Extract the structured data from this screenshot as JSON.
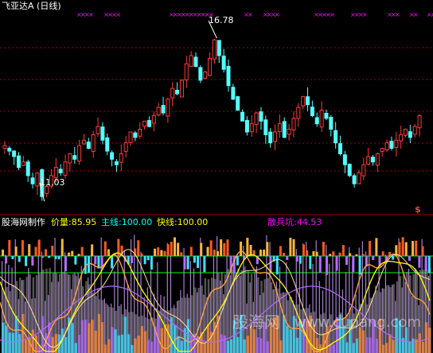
{
  "main_panel": {
    "title": "飞亚达A (日线)",
    "high_label": "16.78",
    "low_label": "11.03",
    "dollar_marker": "$"
  },
  "indicator_panel": {
    "name": "股海网制作",
    "price_label": "价量:85.95",
    "main_label": "主线:100.00",
    "fast_label": "快线:100.00",
    "retail_label": "散兵坑:44.53"
  },
  "watermark": {
    "cn": "股海网",
    "en": "www.cupang.com"
  },
  "colors": {
    "up": "#ff3a3a",
    "down": "#54ffff",
    "grid": "#a00000",
    "magenta": "#ff00ff",
    "yellow": "#ffff00",
    "green": "#00ff00",
    "orange": "#ff9a2e",
    "purple": "#b46cff",
    "violet_bars": "#d0a0ff",
    "gray": "#9a9a9a"
  },
  "chart_data": {
    "type": "candlestick",
    "title": "飞亚达A (日线)",
    "price_high": 16.78,
    "price_low": 11.03,
    "ylim": [
      10.6,
      17.6
    ],
    "close_path": [
      12.9,
      12.7,
      12.5,
      12.1,
      12.3,
      11.8,
      11.5,
      11.9,
      11.03,
      11.4,
      11.8,
      12.1,
      11.9,
      12.3,
      12.6,
      12.4,
      12.9,
      13.1,
      12.8,
      13.3,
      13.6,
      13.1,
      12.7,
      12.4,
      12.2,
      12.6,
      13.0,
      13.4,
      13.2,
      13.5,
      13.8,
      13.6,
      14.0,
      14.3,
      14.1,
      14.6,
      15.0,
      14.8,
      15.3,
      15.9,
      16.2,
      15.8,
      15.3,
      15.6,
      16.1,
      16.78,
      16.2,
      15.7,
      15.1,
      14.6,
      14.2,
      13.8,
      13.4,
      13.7,
      14.1,
      13.8,
      13.3,
      13.0,
      13.4,
      13.7,
      13.2,
      13.5,
      13.9,
      14.3,
      14.7,
      14.4,
      14.0,
      13.7,
      14.2,
      13.9,
      13.5,
      13.0,
      12.6,
      12.2,
      11.8,
      11.5,
      11.9,
      12.2,
      12.5,
      12.3,
      12.6,
      12.8,
      13.0,
      12.8,
      13.1,
      13.3,
      13.5,
      13.2,
      13.6,
      14.0
    ],
    "retail_pit": 44.53,
    "price_volume": 85.95,
    "main_line": 100.0,
    "fast_line": 100.0
  }
}
